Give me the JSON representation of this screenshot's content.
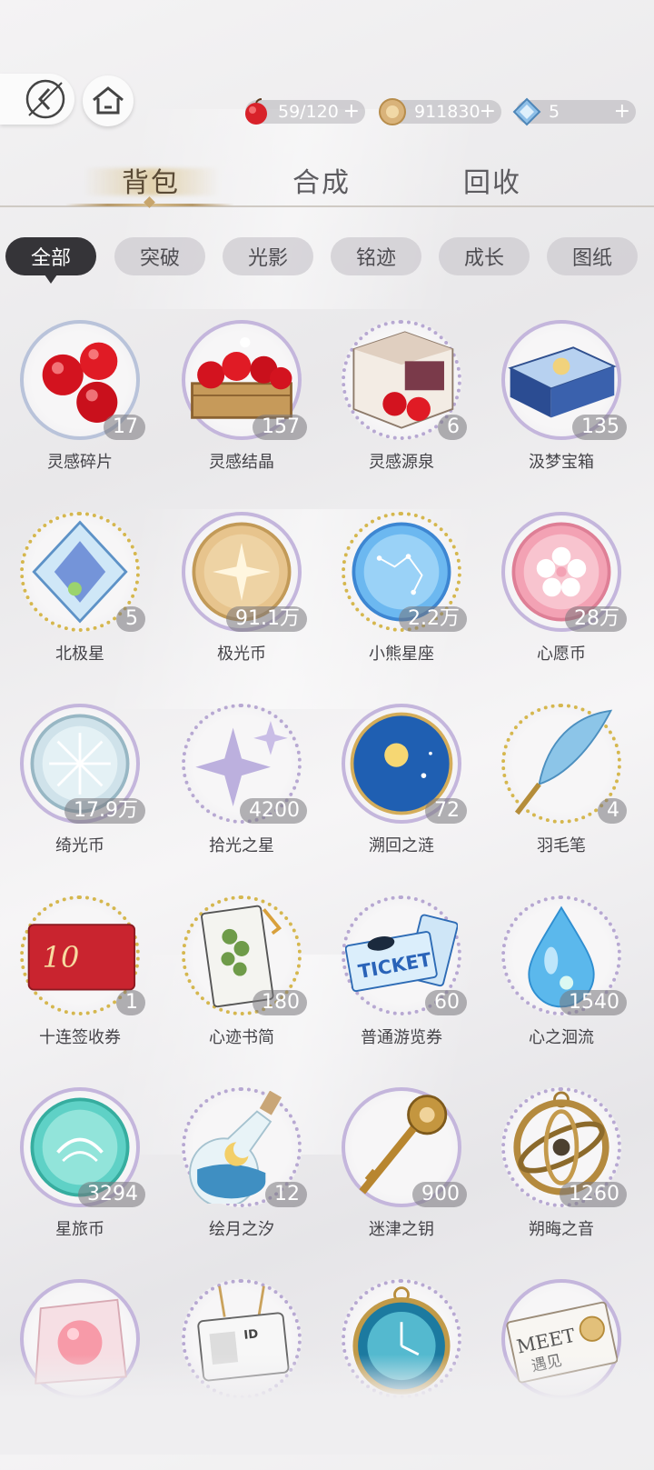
{
  "resources": [
    {
      "icon": "apple-icon",
      "value": "59/120",
      "plus": "+"
    },
    {
      "icon": "coin-icon",
      "value": "911830",
      "plus": "+"
    },
    {
      "icon": "crystal-icon",
      "value": "5",
      "plus": "+"
    }
  ],
  "tabs": [
    {
      "label": "背包",
      "active": true
    },
    {
      "label": "合成",
      "active": false
    },
    {
      "label": "回收",
      "active": false
    }
  ],
  "filters": [
    {
      "label": "全部",
      "active": true
    },
    {
      "label": "突破",
      "active": false
    },
    {
      "label": "光影",
      "active": false
    },
    {
      "label": "铭迹",
      "active": false
    },
    {
      "label": "成长",
      "active": false
    },
    {
      "label": "图纸",
      "active": false
    }
  ],
  "items": [
    {
      "name": "灵感碎片",
      "count": "17",
      "icon": "red-apples-icon"
    },
    {
      "name": "灵感结晶",
      "count": "157",
      "icon": "apple-basket-icon"
    },
    {
      "name": "灵感源泉",
      "count": "6",
      "icon": "apple-crate-icon"
    },
    {
      "name": "汲梦宝箱",
      "count": "135",
      "icon": "blue-box-icon"
    },
    {
      "name": "北极星",
      "count": "5",
      "icon": "blue-crystal-icon"
    },
    {
      "name": "极光币",
      "count": "91.1万",
      "icon": "gold-coin-icon"
    },
    {
      "name": "小熊星座",
      "count": "2.2万",
      "icon": "blue-constellation-coin-icon"
    },
    {
      "name": "心愿币",
      "count": "28万",
      "icon": "pink-flower-coin-icon"
    },
    {
      "name": "绮光币",
      "count": "17.9万",
      "icon": "silver-coin-icon"
    },
    {
      "name": "拾光之星",
      "count": "4200",
      "icon": "purple-star-icon"
    },
    {
      "name": "溯回之涟",
      "count": "72",
      "icon": "sun-moon-orb-icon"
    },
    {
      "name": "羽毛笔",
      "count": "4",
      "icon": "feather-pen-icon"
    },
    {
      "name": "十连签收券",
      "count": "1",
      "icon": "red-card-icon"
    },
    {
      "name": "心迹书简",
      "count": "180",
      "icon": "letter-icon"
    },
    {
      "name": "普通游览券",
      "count": "60",
      "icon": "ticket-icon"
    },
    {
      "name": "心之洄流",
      "count": "1540",
      "icon": "water-drop-icon"
    },
    {
      "name": "星旅币",
      "count": "3294",
      "icon": "teal-coin-icon"
    },
    {
      "name": "绘月之汐",
      "count": "12",
      "icon": "moon-bottle-icon"
    },
    {
      "name": "迷津之钥",
      "count": "900",
      "icon": "golden-key-icon"
    },
    {
      "name": "朔晦之音",
      "count": "1260",
      "icon": "armillary-icon"
    },
    {
      "name": "",
      "count": "",
      "icon": "pink-candy-icon"
    },
    {
      "name": "",
      "count": "",
      "icon": "id-card-icon"
    },
    {
      "name": "",
      "count": "",
      "icon": "pocket-watch-icon"
    },
    {
      "name": "",
      "count": "",
      "icon": "meet-ticket-icon"
    }
  ],
  "meet_ticket_text": {
    "word": "MEET",
    "sub": "遇见"
  },
  "ticket_text": "TICKET",
  "card_text": "10",
  "id_text": "ID"
}
